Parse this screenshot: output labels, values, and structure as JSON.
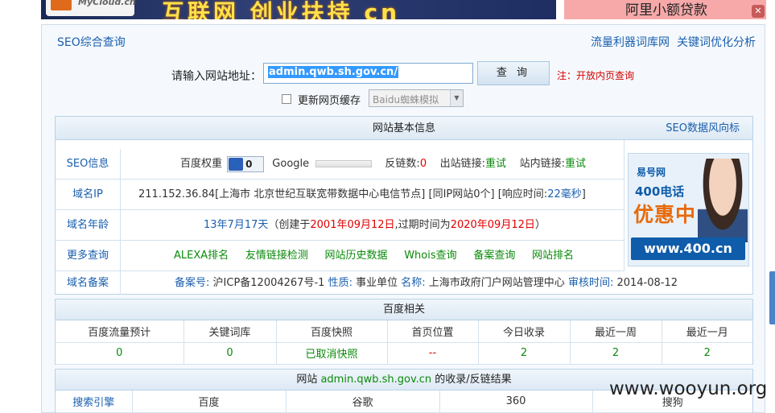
{
  "banner": {
    "logo_text": "MyCloud.cn",
    "slogan": "互联网 创业扶持 cn",
    "ad_right": "阿里小额贷款"
  },
  "header": {
    "left_link": "SEO综合查询",
    "right_links": [
      "流量利器词库网",
      "关键词优化分析"
    ]
  },
  "search": {
    "label": "请输入网站地址：",
    "value": "admin.qwb.sh.gov.cn/",
    "button": "查 询",
    "note": "注：开放内页查询",
    "cache_label": "更新网页缓存",
    "spider_select": "Baidu蜘蛛模拟"
  },
  "basic": {
    "title": "网站基本信息",
    "head_link": "SEO数据风向标",
    "seo": {
      "label": "SEO信息",
      "baidu_weight_label": "百度权重",
      "baidu_weight": "0",
      "google_label": "Google",
      "backlinks_label": "反链数:",
      "backlinks": "0",
      "outlinks_label": "出站链接:",
      "outlinks": "重试",
      "inlinks_label": "站内链接:",
      "inlinks": "重试"
    },
    "ip": {
      "label": "域名IP",
      "text": "211.152.36.84[上海市 北京世纪互联宽带数据中心电信节点] [同IP网站0个] [响应时间:",
      "response": "22毫秒",
      "close": "]"
    },
    "age": {
      "label": "域名年龄",
      "age": "13年7月17天",
      "created_pre": "（创建于",
      "created": "2001年09月12日",
      "expire_pre": ",过期时间为",
      "expire": "2020年09月12日",
      "close": "）"
    },
    "more": {
      "label": "更多查询",
      "links": [
        "ALEXA排名",
        "友情链接检测",
        "网站历史数据",
        "Whois查询",
        "备案查询",
        "网站排名"
      ]
    },
    "icp": {
      "label": "域名备案",
      "no_label": "备案号:",
      "no": "沪ICP备12004267号-1",
      "nature_label": "性质:",
      "nature": "事业单位",
      "name_label": "名称:",
      "name": "上海市政府门户网站管理中心",
      "audit_label": "审核时间:",
      "audit": "2014-08-12"
    },
    "ad": {
      "logo": "易号网",
      "line1": "400电话",
      "line2": "优惠中",
      "url": "www.400.cn"
    }
  },
  "baidu": {
    "title": "百度相关",
    "headers": [
      "百度流量预计",
      "关键词库",
      "百度快照",
      "首页位置",
      "今日收录",
      "最近一周",
      "最近一月"
    ],
    "values": [
      "0",
      "0",
      "已取消快照",
      "--",
      "2",
      "2",
      "2"
    ]
  },
  "results": {
    "title_pre": "网站",
    "domain": "admin.qwb.sh.gov.cn",
    "title_post": "的收录/反链结果",
    "headers": [
      "搜索引擎",
      "百度",
      "谷歌",
      "360",
      "搜狗"
    ]
  },
  "watermark": "www.wooyun.org"
}
